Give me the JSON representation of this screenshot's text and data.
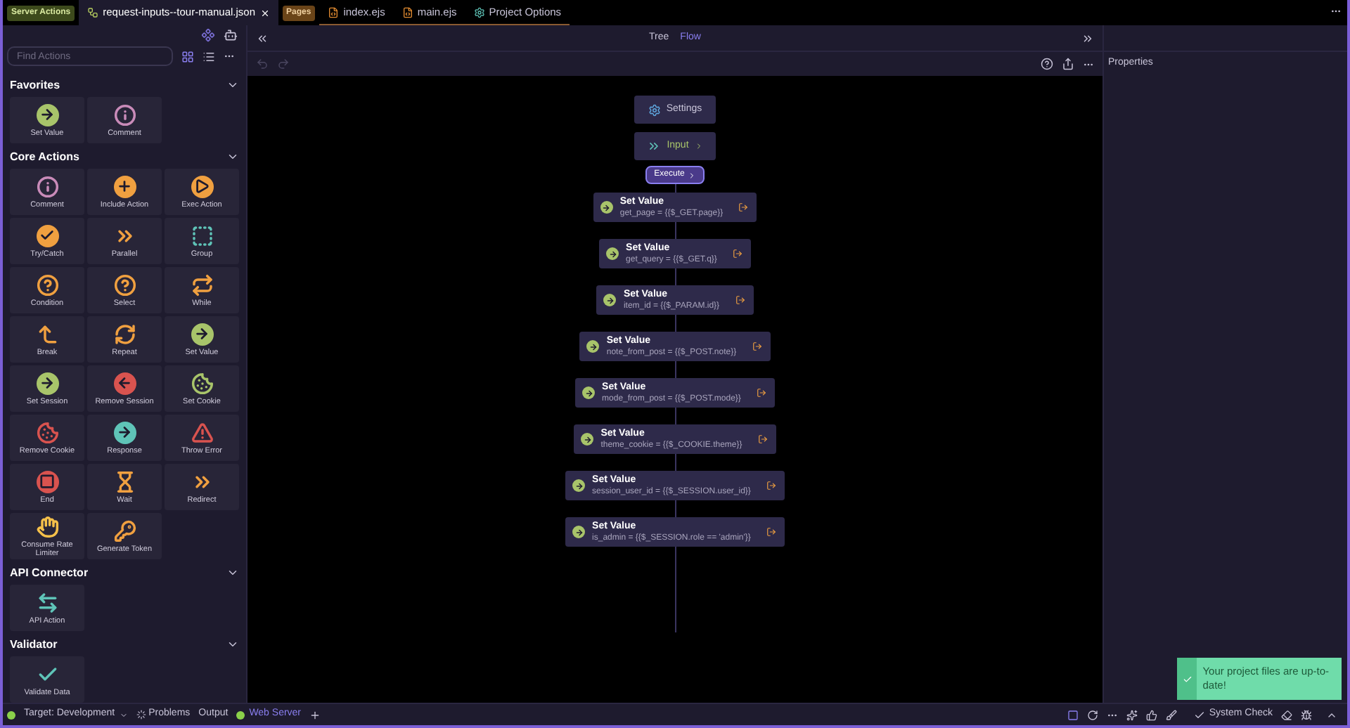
{
  "tabs": [
    {
      "badge": "Server Actions",
      "label": "request-inputs--tour-manual.json",
      "selected": true,
      "closable": true
    },
    {
      "badge": "Pages",
      "label": "index.ejs",
      "selected": false,
      "closable": false
    },
    {
      "label": "main.ejs",
      "selected": false,
      "closable": false
    },
    {
      "label": "Project Options",
      "selected": false,
      "closable": false
    }
  ],
  "sidebar": {
    "search": {
      "placeholder": "Find Actions"
    },
    "sections": [
      {
        "title": "Favorites",
        "expanded": true,
        "items": [
          {
            "label": "Set Value",
            "kind": "setvalue"
          },
          {
            "label": "Comment",
            "kind": "comment"
          }
        ]
      },
      {
        "title": "Core Actions",
        "expanded": true,
        "items": [
          {
            "label": "Comment",
            "kind": "comment"
          },
          {
            "label": "Include Action",
            "kind": "include"
          },
          {
            "label": "Exec Action",
            "kind": "exec"
          },
          {
            "label": "Try/Catch",
            "kind": "trycatch"
          },
          {
            "label": "Parallel",
            "kind": "parallel"
          },
          {
            "label": "Group",
            "kind": "group"
          },
          {
            "label": "Condition",
            "kind": "condition"
          },
          {
            "label": "Select",
            "kind": "select"
          },
          {
            "label": "While",
            "kind": "while"
          },
          {
            "label": "Break",
            "kind": "break"
          },
          {
            "label": "Repeat",
            "kind": "repeat"
          },
          {
            "label": "Set Value",
            "kind": "setvalue"
          },
          {
            "label": "Set Session",
            "kind": "setvalue"
          },
          {
            "label": "Remove Session",
            "kind": "remove"
          },
          {
            "label": "Set Cookie",
            "kind": "cookie"
          },
          {
            "label": "Remove Cookie",
            "kind": "removecookie"
          },
          {
            "label": "Response",
            "kind": "response"
          },
          {
            "label": "Throw Error",
            "kind": "error"
          },
          {
            "label": "End",
            "kind": "end"
          },
          {
            "label": "Wait",
            "kind": "wait"
          },
          {
            "label": "Redirect",
            "kind": "parallel"
          },
          {
            "label": "Consume Rate Limiter",
            "kind": "hand"
          },
          {
            "label": "Generate Token",
            "kind": "key"
          }
        ]
      },
      {
        "title": "API Connector",
        "expanded": true,
        "items": [
          {
            "label": "API Action",
            "kind": "api"
          }
        ]
      },
      {
        "title": "Validator",
        "expanded": true,
        "items": [
          {
            "label": "Validate Data",
            "kind": "validate"
          }
        ]
      }
    ]
  },
  "view_toggle": [
    {
      "label": "Tree",
      "selected": false
    },
    {
      "label": "Flow",
      "selected": true
    }
  ],
  "flow": {
    "settings": "Settings",
    "input": "Input",
    "execute": "Execute",
    "steps": [
      {
        "title": "Set Value",
        "expression": "get_page = {{$_GET.page}}"
      },
      {
        "title": "Set Value",
        "expression": "get_query = {{$_GET.q}}"
      },
      {
        "title": "Set Value",
        "expression": "item_id = {{$_PARAM.id}}"
      },
      {
        "title": "Set Value",
        "expression": "note_from_post = {{$_POST.note}}"
      },
      {
        "title": "Set Value",
        "expression": "mode_from_post = {{$_POST.mode}}"
      },
      {
        "title": "Set Value",
        "expression": "theme_cookie = {{$_COOKIE.theme}}"
      },
      {
        "title": "Set Value",
        "expression": "session_user_id = {{$_SESSION.user_id}}"
      },
      {
        "title": "Set Value",
        "expression": "is_admin = {{$_SESSION.role == 'admin'}}"
      }
    ]
  },
  "properties": {
    "title": "Properties"
  },
  "status_bar": {
    "target": "Target: Development",
    "problems": "Problems",
    "output": "Output",
    "server": "Web Server",
    "system_check": "System Check"
  },
  "toast": {
    "message": "Your project files are up-to-date!"
  }
}
